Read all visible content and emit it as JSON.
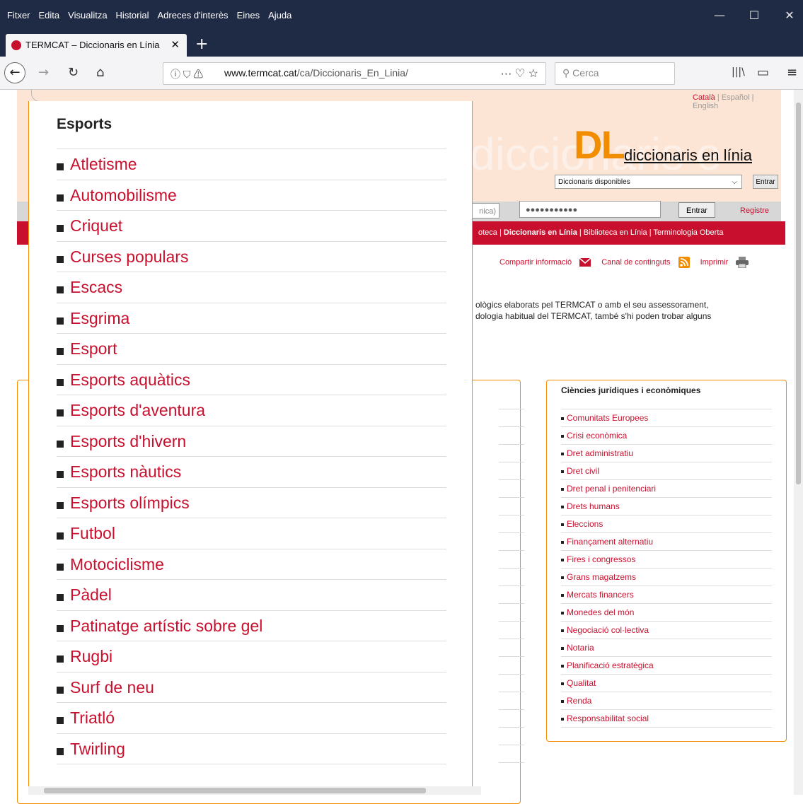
{
  "menubar": {
    "items": [
      "Fitxer",
      "Edita",
      "Visualitza",
      "Historial",
      "Adreces d'interès",
      "Eines",
      "Ajuda"
    ],
    "minimize": "—",
    "maximize": "☐",
    "close": "✕"
  },
  "tab": {
    "title": "TERMCAT – Diccionaris en Línia",
    "close": "✕",
    "new_tab": "+"
  },
  "navbar": {
    "back": "←",
    "forward": "→",
    "reload": "↻",
    "home": "⌂",
    "url_domain": "www.termcat.cat",
    "url_path": "/ca/Diccionaris_En_Linia/",
    "url_actions": "···  ♡  ☆",
    "search_placeholder": "Cerca",
    "library": "|||\\",
    "sidebar": "▭",
    "menu": "≡"
  },
  "banner": {
    "lang_current": "Català",
    "lang_es": "Español",
    "lang_en": "English",
    "logo": "DL",
    "logo_text": "diccionaris en línia",
    "ghost_text": "diccionaris e",
    "select_value": "Diccionaris disponibles",
    "entrar": "Entrar"
  },
  "login": {
    "user_partial": "nica)",
    "password_mask": "●●●●●●●●●●●",
    "entrar": "Entrar",
    "registre": "Registre"
  },
  "rednav": {
    "text_a": "oteca | ",
    "text_b": "Diccionaris en Línia",
    "text_c": " | Biblioteca en Línia | Terminologia Oberta"
  },
  "actions": {
    "share": "Compartir informació",
    "feed": "Canal de continguts",
    "print": "Imprimir"
  },
  "intro": {
    "line1": "ològics elaborats pel TERMCAT o amb el seu assessorament,",
    "line2": "dologia habitual del TERMCAT, també s'hi poden trobar alguns"
  },
  "rightbox": {
    "title": "Ciències jurídiques i econòmiques",
    "items": [
      "Comunitats Europees",
      "Crisi econòmica",
      "Dret administratiu",
      "Dret civil",
      "Dret penal i penitenciari",
      "Drets humans",
      "Eleccions",
      "Finançament alternatiu",
      "Fires i congressos",
      "Grans magatzems",
      "Mercats financers",
      "Monedes del món",
      "Negociació col·lectiva",
      "Notaria",
      "Planificació estratègica",
      "Qualitat",
      "Renda",
      "Responsabilitat social"
    ]
  },
  "popup": {
    "title": "Esports",
    "items": [
      "Atletisme",
      "Automobilisme",
      "Criquet",
      "Curses populars",
      "Escacs",
      "Esgrima",
      "Esport",
      "Esports aquàtics",
      "Esports d'aventura",
      "Esports d'hivern",
      "Esports nàutics",
      "Esports olímpics",
      "Futbol",
      "Motociclisme",
      "Pàdel",
      "Patinatge artístic sobre gel",
      "Rugbi",
      "Surf de neu",
      "Triatló",
      "Twirling"
    ]
  }
}
